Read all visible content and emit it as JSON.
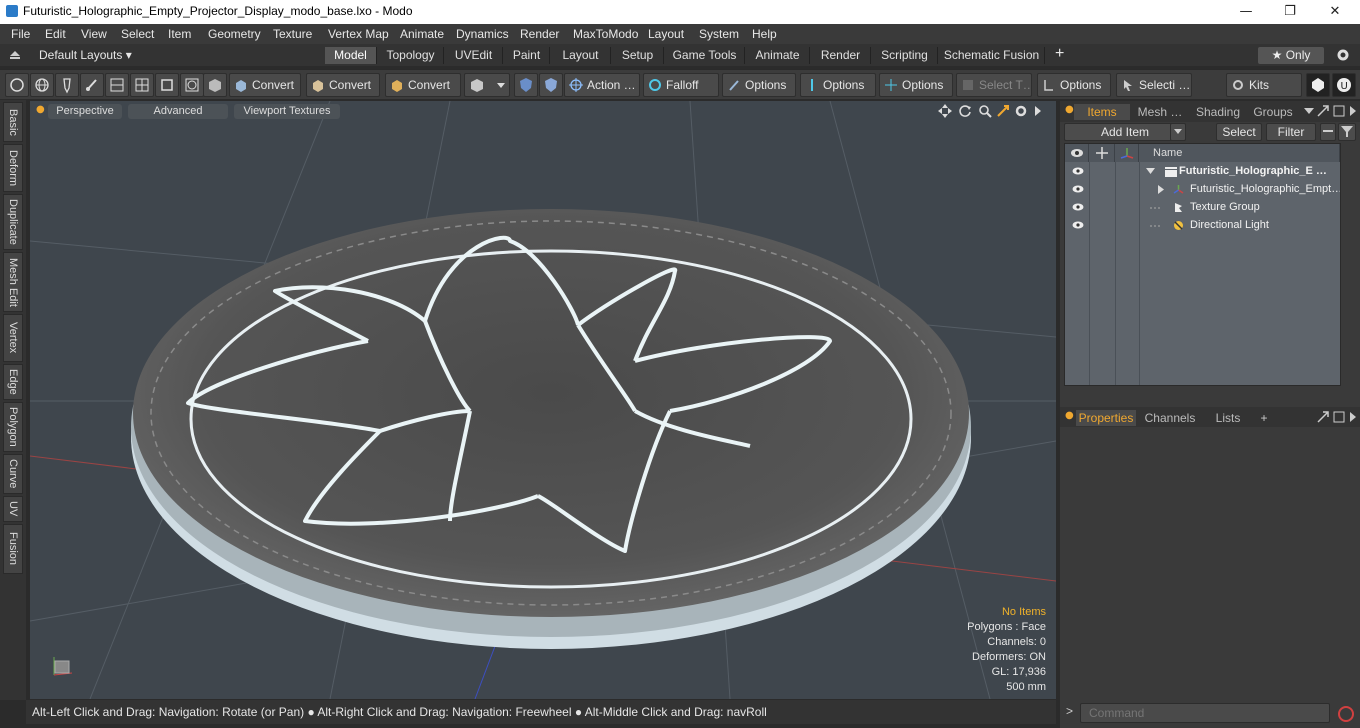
{
  "window": {
    "title": "Futuristic_Holographic_Empty_Projector_Display_modo_base.lxo - Modo",
    "minimize": "—",
    "maximize": "❐",
    "close": "✕"
  },
  "menu": [
    "File",
    "Edit",
    "View",
    "Select",
    "Item",
    "Geometry",
    "Texture",
    "Vertex Map",
    "Animate",
    "Dynamics",
    "Render",
    "MaxToModo",
    "Layout",
    "System",
    "Help"
  ],
  "layouts": {
    "dropdown": "Default Layouts ▾",
    "tabs": [
      "Model",
      "Topology",
      "UVEdit",
      "Paint",
      "Layout",
      "Setup",
      "Game Tools",
      "Animate",
      "Render",
      "Scripting",
      "Schematic Fusion"
    ],
    "active_tab": "Model",
    "add": "+",
    "only_label": "★  Only"
  },
  "toolbar": {
    "convert1": "Convert",
    "convert2": "Convert",
    "convert3": "Convert",
    "action": "Action …",
    "falloff": "Falloff",
    "options1": "Options",
    "options2": "Options",
    "options3": "Options",
    "select_t": "Select T…",
    "options4": "Options",
    "selecti": "Selecti …",
    "kits": "Kits"
  },
  "left_tabs": [
    "Basic",
    "Deform",
    "Duplicate",
    "Mesh Edit",
    "Vertex",
    "Edge",
    "Polygon",
    "Curve",
    "UV",
    "Fusion"
  ],
  "viewport": {
    "tabs": [
      "Perspective",
      "Advanced",
      "Viewport Textures"
    ],
    "info": {
      "no_items": "No Items",
      "polygons": "Polygons : Face",
      "channels": "Channels: 0",
      "deformers": "Deformers: ON",
      "gl": "GL: 17,936",
      "scale": "500 mm"
    }
  },
  "status_bar": "Alt-Left Click and Drag: Navigation: Rotate (or Pan) ● Alt-Right Click and Drag: Navigation: Freewheel ● Alt-Middle Click and Drag: navRoll",
  "items_panel": {
    "tabs": [
      "Items",
      "Mesh …",
      "Shading",
      "Groups"
    ],
    "add_item": "Add Item",
    "select": "Select",
    "filter": "Filter",
    "column_name": "Name",
    "rows": [
      {
        "label": "Futuristic_Holographic_E  …",
        "bold": true
      },
      {
        "label": "Futuristic_Holographic_Empt…",
        "bold": false
      },
      {
        "label": "Texture Group",
        "bold": false
      },
      {
        "label": "Directional Light",
        "bold": false
      }
    ]
  },
  "properties_panel": {
    "tabs": [
      "Properties",
      "Channels",
      "Lists"
    ],
    "add": "+"
  },
  "command": {
    "prompt": ">",
    "placeholder": "Command"
  }
}
